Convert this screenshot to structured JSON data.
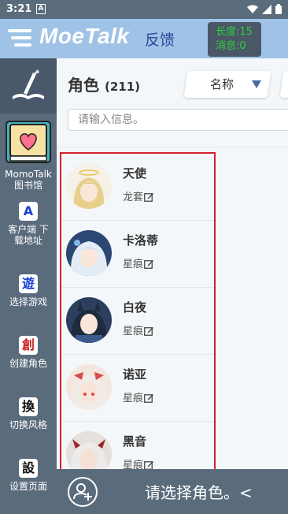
{
  "status_bar": {
    "time": "3:21",
    "a_icon": "A",
    "icons": [
      "wifi-icon",
      "signal-icon",
      "battery-icon"
    ]
  },
  "header": {
    "app_title": "MoeTalk",
    "feedback": "反馈",
    "length_label": "长度:15",
    "message_label": "消息:0",
    "colors": {
      "header_bg": "#9fc3e6",
      "counter_text": "#2ccf3c"
    }
  },
  "sidebar": {
    "items": [
      {
        "icon": "book-heart-icon",
        "label": "MomoTalk图书馆"
      },
      {
        "badge": "A",
        "badge_color": "#1a3fd1",
        "label": "客户端 下载地址"
      },
      {
        "badge": "遊",
        "badge_color": "#1a3fd1",
        "label": "选择游戏"
      },
      {
        "badge": "創",
        "badge_color": "#d01f1f",
        "label": "创建角色"
      },
      {
        "badge": "換",
        "badge_color": "#111111",
        "label": "切换风格"
      },
      {
        "badge": "設",
        "badge_color": "#111111",
        "label": "设置页面"
      }
    ]
  },
  "main": {
    "title": "角色",
    "count": "(211)",
    "sort_label": "名称",
    "search_placeholder": "请输入信息。",
    "characters": [
      {
        "name": "天使",
        "sub": "龙套"
      },
      {
        "name": "卡洛蒂",
        "sub": "星痕"
      },
      {
        "name": "白夜",
        "sub": "星痕"
      },
      {
        "name": "诺亚",
        "sub": "星痕"
      },
      {
        "name": "黑音",
        "sub": "星痕"
      }
    ]
  },
  "bottom": {
    "prompt": "请选择角色。<",
    "add_icon": "add-user-icon"
  }
}
